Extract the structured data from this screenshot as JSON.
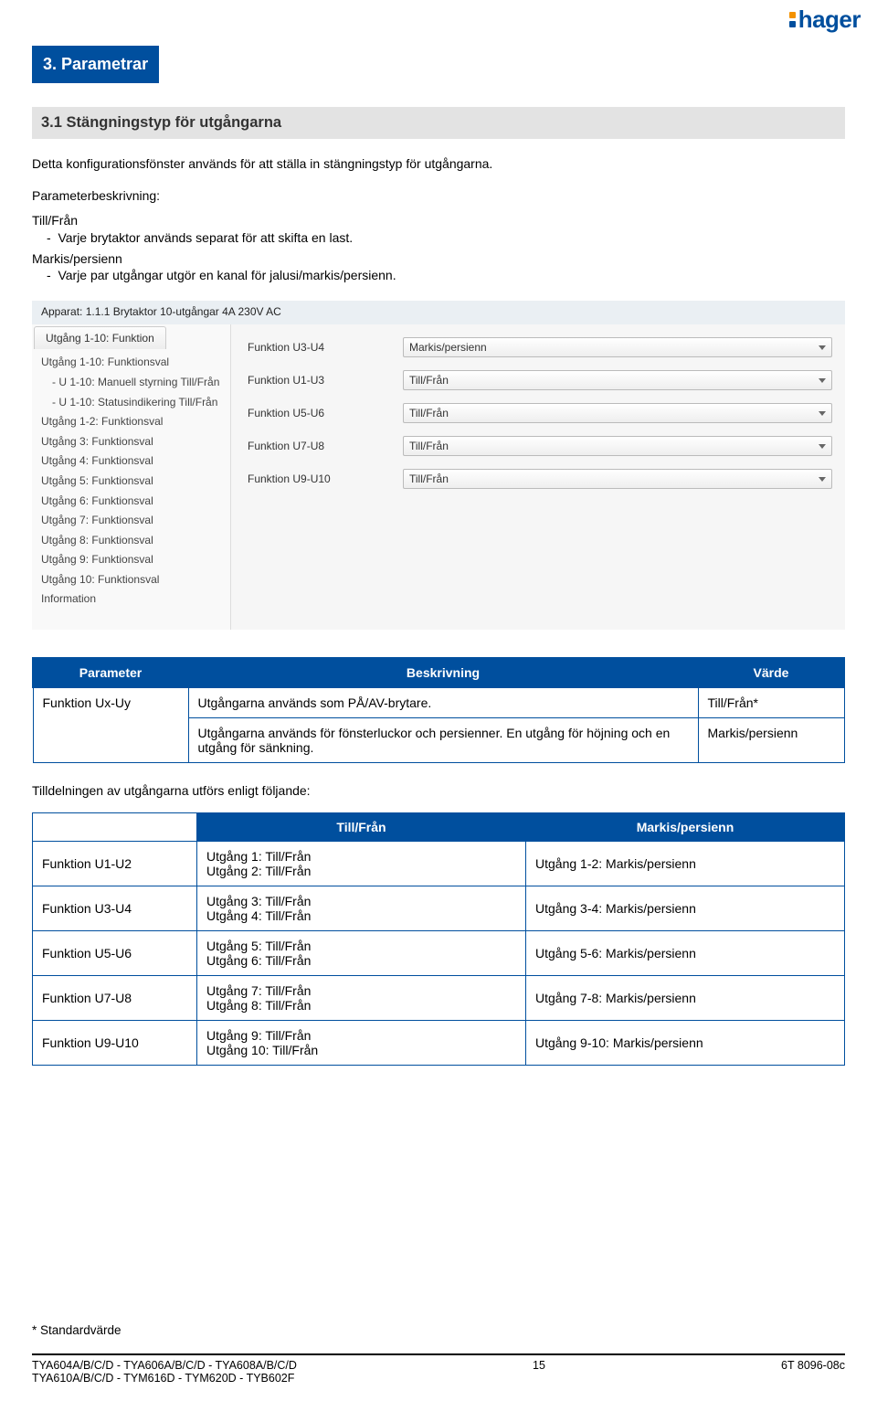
{
  "logo": {
    "text": "hager"
  },
  "headings": {
    "h1": "3. Parametrar",
    "h2": "3.1 Stängningstyp för utgångarna"
  },
  "intro": "Detta konfigurationsfönster används för att ställa in stängningstyp för utgångarna.",
  "param_desc_label": "Parameterbeskrivning:",
  "group1": {
    "title": "Till/Från",
    "line": "Varje brytaktor används separat för att skifta en last."
  },
  "group2": {
    "title": "Markis/persienn",
    "line": "Varje par utgångar utgör en kanal för jalusi/markis/persienn."
  },
  "screenshot": {
    "apparat": "Apparat: 1.1.1 Brytaktor 10-utgångar 4A 230V AC",
    "tab": "Utgång 1-10: Funktion",
    "left_items": [
      "Utgång 1-10: Funktionsval",
      " - U 1-10: Manuell styrning Till/Från",
      " - U 1-10: Statusindikering Till/Från",
      "Utgång 1-2: Funktionsval",
      "Utgång 3: Funktionsval",
      "Utgång 4: Funktionsval",
      "Utgång 5: Funktionsval",
      "Utgång 6: Funktionsval",
      "Utgång 7: Funktionsval",
      "Utgång 8: Funktionsval",
      "Utgång 9: Funktionsval",
      "Utgång 10: Funktionsval",
      "Information"
    ],
    "rows": [
      {
        "label": "Funktion U3-U4",
        "value": "Markis/persienn"
      },
      {
        "label": "Funktion U1-U3",
        "value": "Till/Från"
      },
      {
        "label": "Funktion U5-U6",
        "value": "Till/Från"
      },
      {
        "label": "Funktion U7-U8",
        "value": "Till/Från"
      },
      {
        "label": "Funktion U9-U10",
        "value": "Till/Från"
      }
    ]
  },
  "table1": {
    "headers": {
      "c1": "Parameter",
      "c2": "Beskrivning",
      "c3": "Värde"
    },
    "rows": [
      {
        "c1": "Funktion Ux-Uy",
        "c2": "Utgångarna används som PÅ/AV-brytare.",
        "c3": "Till/Från*"
      },
      {
        "c1": "",
        "c2": "Utgångarna används för fönsterluckor och persienner. En utgång för höjning och en utgång för sänkning.",
        "c3": "Markis/persienn"
      }
    ]
  },
  "section_label": "Tilldelningen av utgångarna utförs enligt följande:",
  "table2": {
    "headers": {
      "c2": "Till/Från",
      "c3": "Markis/persienn"
    },
    "rows": [
      {
        "c1": "Funktion U1-U2",
        "c2": "Utgång 1: Till/Från\nUtgång 2: Till/Från",
        "c3": "Utgång 1-2: Markis/persienn"
      },
      {
        "c1": "Funktion U3-U4",
        "c2": "Utgång 3: Till/Från\nUtgång 4: Till/Från",
        "c3": "Utgång 3-4: Markis/persienn"
      },
      {
        "c1": "Funktion U5-U6",
        "c2": "Utgång 5: Till/Från\nUtgång 6: Till/Från",
        "c3": "Utgång 5-6: Markis/persienn"
      },
      {
        "c1": "Funktion U7-U8",
        "c2": "Utgång 7: Till/Från\nUtgång 8: Till/Från",
        "c3": "Utgång 7-8: Markis/persienn"
      },
      {
        "c1": "Funktion U9-U10",
        "c2": "Utgång 9: Till/Från\nUtgång 10: Till/Från",
        "c3": "Utgång 9-10: Markis/persienn"
      }
    ]
  },
  "footnote": "* Standardvärde",
  "footer": {
    "left1": "TYA604A/B/C/D - TYA606A/B/C/D - TYA608A/B/C/D",
    "left2": "TYA610A/B/C/D - TYM616D - TYM620D - TYB602F",
    "mid": "15",
    "right": "6T 8096-08c"
  }
}
